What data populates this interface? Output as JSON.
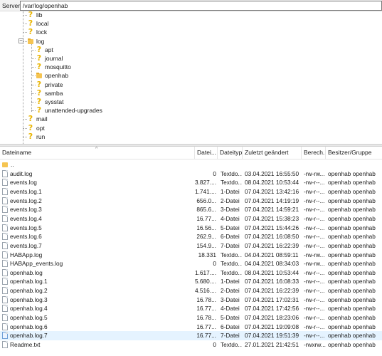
{
  "server_bar": {
    "label": "Server:",
    "path": "/var/log/openhab"
  },
  "tree": {
    "root_items": [
      {
        "name": "lib",
        "icon": "question"
      },
      {
        "name": "local",
        "icon": "question"
      },
      {
        "name": "lock",
        "icon": "question"
      }
    ],
    "log_folder": {
      "name": "log",
      "icon": "folder",
      "expanded_symbol": "−"
    },
    "log_children": [
      {
        "name": "apt",
        "icon": "question"
      },
      {
        "name": "journal",
        "icon": "question"
      },
      {
        "name": "mosquitto",
        "icon": "question"
      },
      {
        "name": "openhab",
        "icon": "folder"
      },
      {
        "name": "private",
        "icon": "question"
      },
      {
        "name": "samba",
        "icon": "question"
      },
      {
        "name": "sysstat",
        "icon": "question"
      },
      {
        "name": "unattended-upgrades",
        "icon": "question"
      }
    ],
    "after_items": [
      {
        "name": "mail",
        "icon": "question"
      },
      {
        "name": "opt",
        "icon": "question"
      },
      {
        "name": "run",
        "icon": "question"
      }
    ]
  },
  "columns": {
    "name": "Dateiname",
    "size": "Datei...",
    "type": "Dateityp",
    "date": "Zuletzt geändert",
    "perm": "Berech...",
    "owner": "Besitzer/Gruppe"
  },
  "parent_row": "..",
  "files": [
    {
      "name": "audit.log",
      "size": "0",
      "type": "Textdo...",
      "date": "03.04.2021 16:55:50",
      "perm": "-rw-rw...",
      "owner": "openhab openhab"
    },
    {
      "name": "events.log",
      "size": "3.827....",
      "type": "Textdo...",
      "date": "08.04.2021 10:53:44",
      "perm": "-rw-r--...",
      "owner": "openhab openhab"
    },
    {
      "name": "events.log.1",
      "size": "1.741....",
      "type": "1-Datei",
      "date": "07.04.2021 13:42:16",
      "perm": "-rw-r--...",
      "owner": "openhab openhab"
    },
    {
      "name": "events.log.2",
      "size": "656.0...",
      "type": "2-Datei",
      "date": "07.04.2021 14:19:19",
      "perm": "-rw-r--...",
      "owner": "openhab openhab"
    },
    {
      "name": "events.log.3",
      "size": "865.6...",
      "type": "3-Datei",
      "date": "07.04.2021 14:59:21",
      "perm": "-rw-r--...",
      "owner": "openhab openhab"
    },
    {
      "name": "events.log.4",
      "size": "16.77...",
      "type": "4-Datei",
      "date": "07.04.2021 15:38:23",
      "perm": "-rw-r--...",
      "owner": "openhab openhab"
    },
    {
      "name": "events.log.5",
      "size": "16.56...",
      "type": "5-Datei",
      "date": "07.04.2021 15:44:26",
      "perm": "-rw-r--...",
      "owner": "openhab openhab"
    },
    {
      "name": "events.log.6",
      "size": "262.9...",
      "type": "6-Datei",
      "date": "07.04.2021 16:08:50",
      "perm": "-rw-r--...",
      "owner": "openhab openhab"
    },
    {
      "name": "events.log.7",
      "size": "154.9...",
      "type": "7-Datei",
      "date": "07.04.2021 16:22:39",
      "perm": "-rw-r--...",
      "owner": "openhab openhab"
    },
    {
      "name": "HABApp.log",
      "size": "18.331",
      "type": "Textdo...",
      "date": "04.04.2021 08:59:11",
      "perm": "-rw-rw...",
      "owner": "openhab openhab"
    },
    {
      "name": "HABApp_events.log",
      "size": "0",
      "type": "Textdo...",
      "date": "04.04.2021 08:34:03",
      "perm": "-rw-rw...",
      "owner": "openhab openhab"
    },
    {
      "name": "openhab.log",
      "size": "1.617....",
      "type": "Textdo...",
      "date": "08.04.2021 10:53:44",
      "perm": "-rw-r--...",
      "owner": "openhab openhab"
    },
    {
      "name": "openhab.log.1",
      "size": "5.680....",
      "type": "1-Datei",
      "date": "07.04.2021 16:08:33",
      "perm": "-rw-r--...",
      "owner": "openhab openhab"
    },
    {
      "name": "openhab.log.2",
      "size": "4.516....",
      "type": "2-Datei",
      "date": "07.04.2021 16:22:39",
      "perm": "-rw-r--...",
      "owner": "openhab openhab"
    },
    {
      "name": "openhab.log.3",
      "size": "16.78...",
      "type": "3-Datei",
      "date": "07.04.2021 17:02:31",
      "perm": "-rw-r--...",
      "owner": "openhab openhab"
    },
    {
      "name": "openhab.log.4",
      "size": "16.77...",
      "type": "4-Datei",
      "date": "07.04.2021 17:42:56",
      "perm": "-rw-r--...",
      "owner": "openhab openhab"
    },
    {
      "name": "openhab.log.5",
      "size": "16.78...",
      "type": "5-Datei",
      "date": "07.04.2021 18:23:06",
      "perm": "-rw-r--...",
      "owner": "openhab openhab"
    },
    {
      "name": "openhab.log.6",
      "size": "16.77...",
      "type": "6-Datei",
      "date": "07.04.2021 19:09:08",
      "perm": "-rw-r--...",
      "owner": "openhab openhab"
    },
    {
      "name": "openhab.log.7",
      "size": "16.77...",
      "type": "7-Datei",
      "date": "07.04.2021 19:51:39",
      "perm": "-rw-r--...",
      "owner": "openhab openhab",
      "selected": true
    },
    {
      "name": "Readme.txt",
      "size": "0",
      "type": "Textdo...",
      "date": "27.01.2021 21:42:51",
      "perm": "-rwxrw...",
      "owner": "openhab openhab"
    }
  ]
}
